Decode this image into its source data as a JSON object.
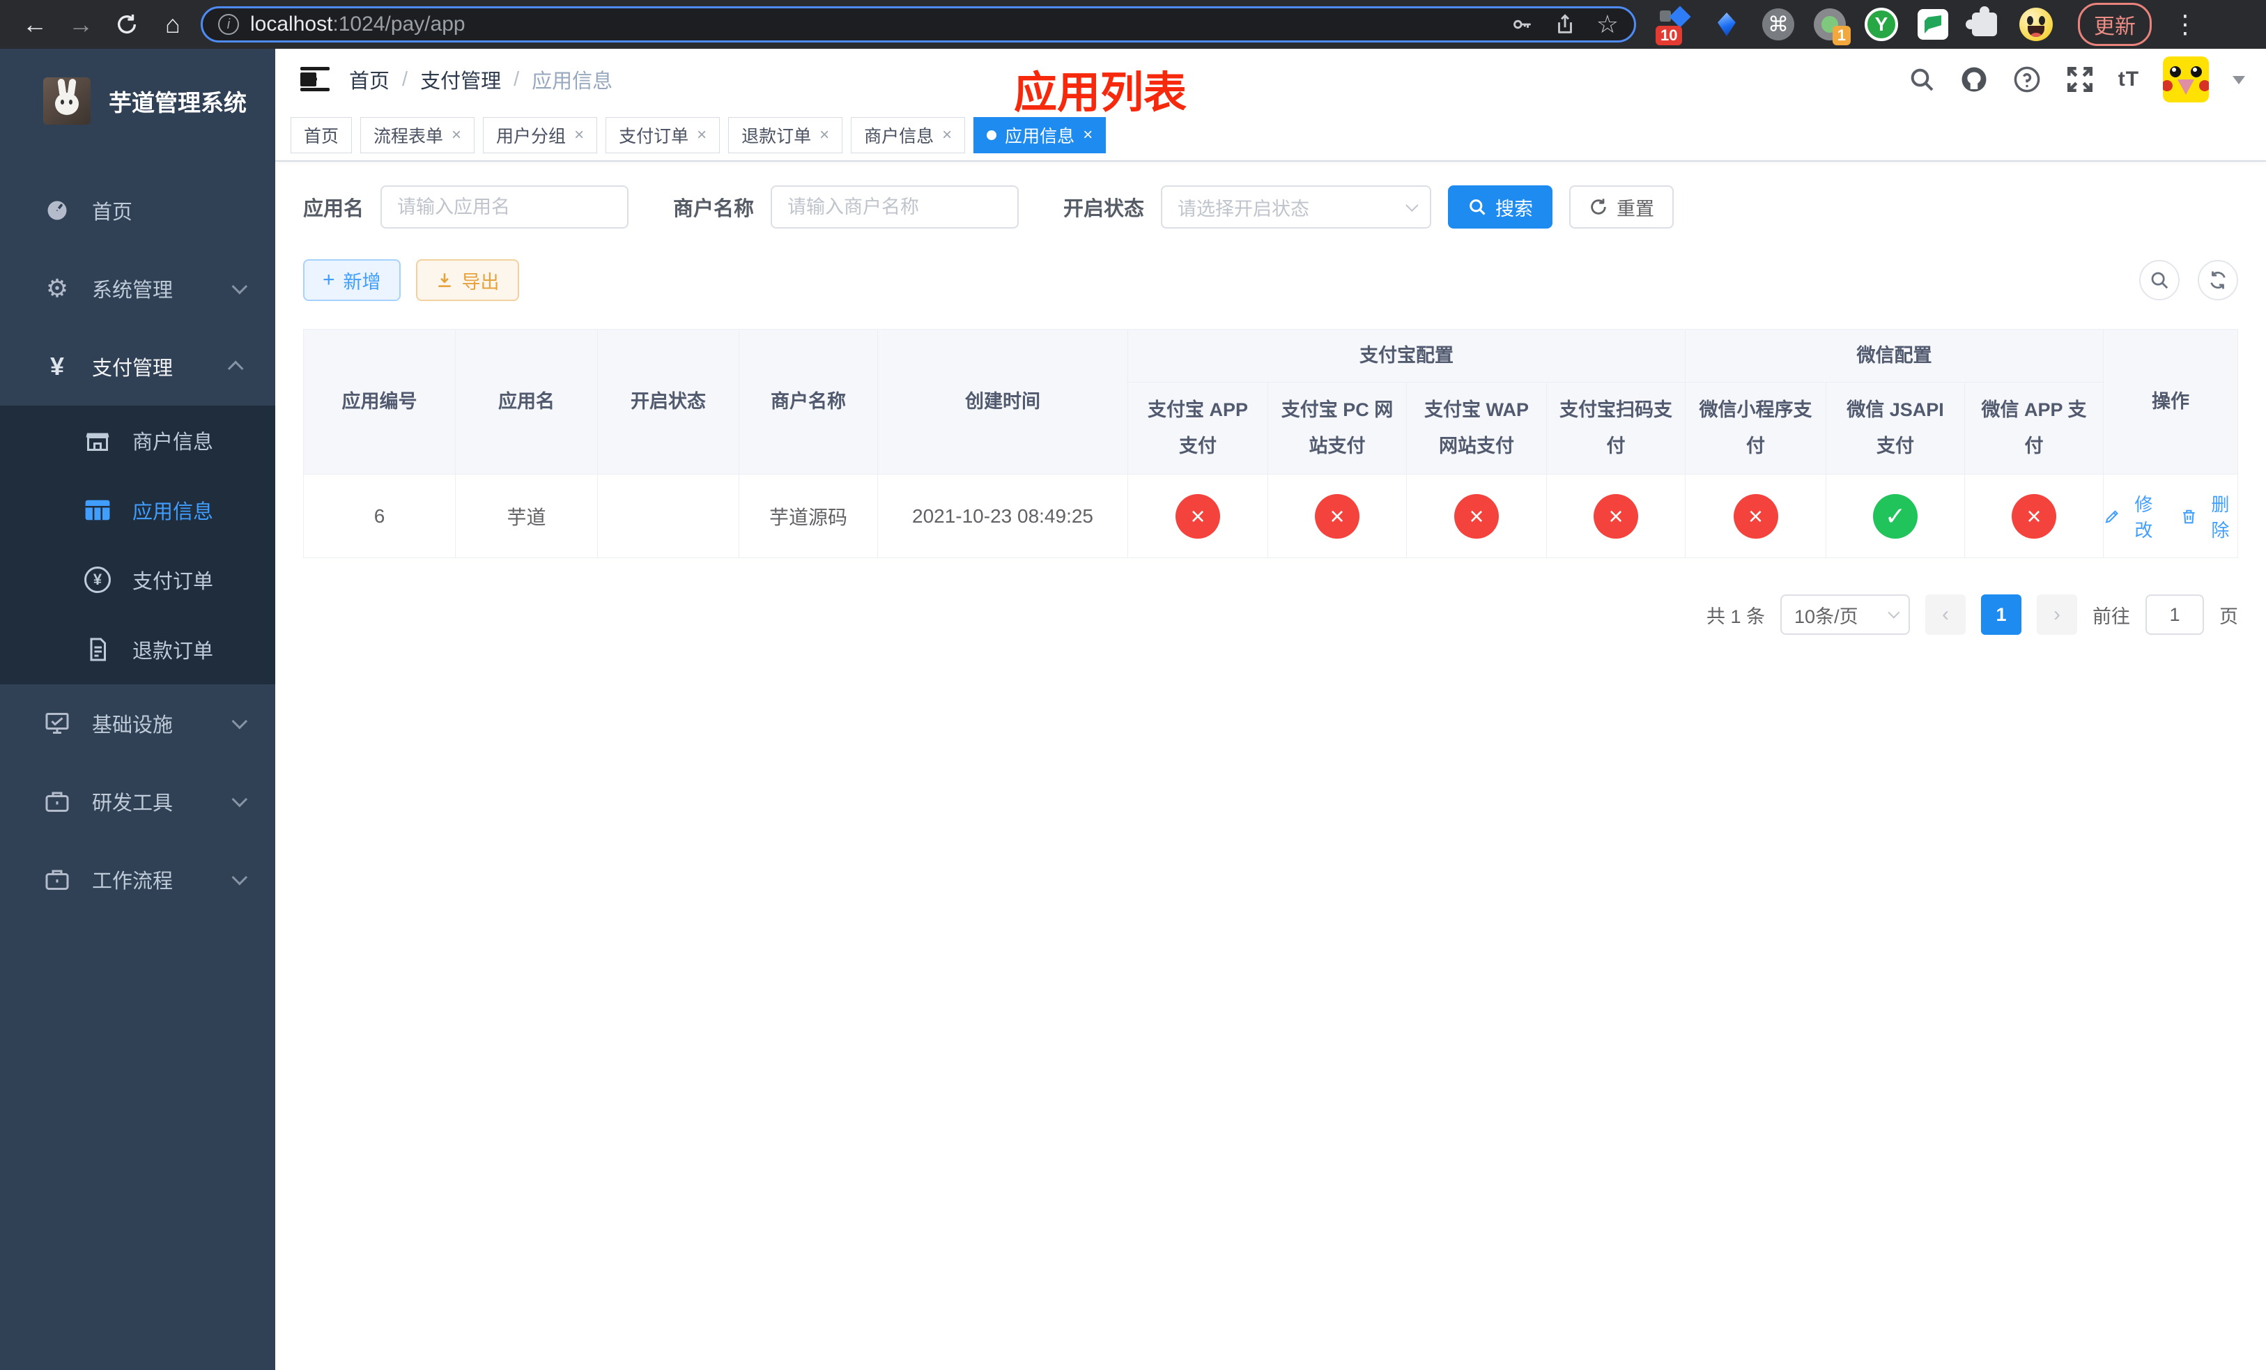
{
  "browser": {
    "url_host": "localhost",
    "url_rest": ":1024/pay/app",
    "update_label": "更新",
    "badge_scripts": "10",
    "badge_switch": "1",
    "y_ext": "Y"
  },
  "icons": {
    "back": "←",
    "forward": "→",
    "home": "⌂",
    "info": "i",
    "star": "☆",
    "command": "⌘",
    "menu_dots": "⋮",
    "yen": "¥",
    "gear": "⚙",
    "prev": "‹",
    "next": "›",
    "plus": "+",
    "font_size": "tT",
    "question": "?",
    "close": "×",
    "slash": "/"
  },
  "sidebar": {
    "title": "芋道管理系统",
    "menu": [
      {
        "label": "首页"
      },
      {
        "label": "系统管理"
      },
      {
        "label": "支付管理"
      },
      {
        "label": "基础设施"
      },
      {
        "label": "研发工具"
      },
      {
        "label": "工作流程"
      }
    ],
    "submenu": [
      {
        "label": "商户信息"
      },
      {
        "label": "应用信息"
      },
      {
        "label": "支付订单"
      },
      {
        "label": "退款订单"
      }
    ]
  },
  "navbar": {
    "breadcrumb": [
      "首页",
      "支付管理",
      "应用信息"
    ]
  },
  "annotation": "应用列表",
  "tabs": [
    {
      "label": "首页"
    },
    {
      "label": "流程表单"
    },
    {
      "label": "用户分组"
    },
    {
      "label": "支付订单"
    },
    {
      "label": "退款订单"
    },
    {
      "label": "商户信息"
    },
    {
      "label": "应用信息"
    }
  ],
  "filters": {
    "app_name_label": "应用名",
    "app_name_placeholder": "请输入应用名",
    "merchant_label": "商户名称",
    "merchant_placeholder": "请输入商户名称",
    "status_label": "开启状态",
    "status_placeholder": "请选择开启状态",
    "search_label": "搜索",
    "reset_label": "重置"
  },
  "toolbar": {
    "add_label": "新增",
    "export_label": "导出"
  },
  "table": {
    "columns": [
      "应用编号",
      "应用名",
      "开启状态",
      "商户名称",
      "创建时间"
    ],
    "groups": [
      {
        "label": "支付宝配置",
        "children": [
          "支付宝 APP 支付",
          "支付宝 PC 网站支付",
          "支付宝 WAP 网站支付",
          "支付宝扫码支付"
        ]
      },
      {
        "label": "微信配置",
        "children": [
          "微信小程序支付",
          "微信 JSAPI 支付",
          "微信 APP 支付"
        ]
      }
    ],
    "ops_label": "操作",
    "row": {
      "id": "6",
      "name": "芋道",
      "enabled": true,
      "merchant": "芋道源码",
      "created": "2021-10-23 08:49:25",
      "statuses": [
        false,
        false,
        false,
        false,
        false,
        true,
        false
      ],
      "edit_label": "修改",
      "delete_label": "删除"
    }
  },
  "pagination": {
    "total": "共 1 条",
    "page_size": "10条/页",
    "current": "1",
    "goto_label": "前往",
    "goto_value": "1",
    "page_unit": "页"
  },
  "colors": {
    "primary": "#1e8bf1",
    "link": "#409EFF",
    "success": "#21c45a",
    "danger": "#f4433c",
    "warning": "#e6a23c",
    "sidebar": "#304156",
    "submenu": "#1f2d3d",
    "annotation": "#f6290c"
  }
}
